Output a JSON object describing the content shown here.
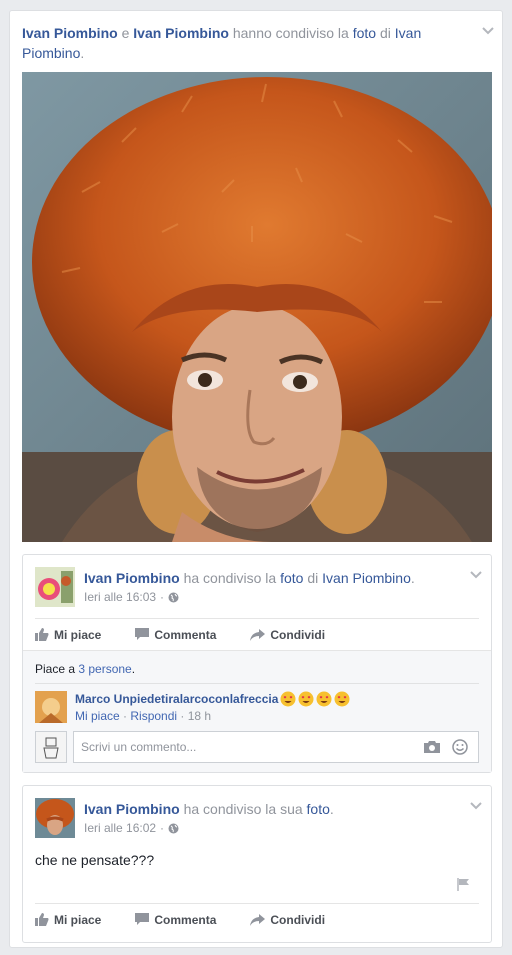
{
  "story": {
    "author1": "Ivan Piombino",
    "conj": " e ",
    "author2": "Ivan Piombino",
    "verb": " hanno condiviso la ",
    "object": "foto",
    "prep": " di ",
    "owner": "Ivan Piombino",
    "period": "."
  },
  "post1": {
    "author": "Ivan Piombino",
    "verb": " ha condiviso la ",
    "object": "foto",
    "prep": " di ",
    "owner": "Ivan Piombino",
    "period": ".",
    "time": "Ieri alle 16:03",
    "dot": " · ",
    "actions": {
      "like": "Mi piace",
      "comment": "Commenta",
      "share": "Condividi"
    },
    "likes_prefix": "Piace a ",
    "likes_link": "3 persone",
    "likes_suffix": ".",
    "comment": {
      "author": "Marco Unpiedetiralarcoconlafreccia",
      "like": "Mi piace",
      "sep": " · ",
      "reply": "Rispondi",
      "sep2": " · ",
      "age": "18 h"
    },
    "reply_placeholder": "Scrivi un commento..."
  },
  "post2": {
    "author": "Ivan Piombino",
    "verb": " ha condiviso la sua ",
    "object": "foto",
    "period": ".",
    "time": "Ieri alle 16:02",
    "dot": " · ",
    "text": "che ne pensate???",
    "actions": {
      "like": "Mi piace",
      "comment": "Commenta",
      "share": "Condividi"
    }
  },
  "colors": {
    "link": "#365899",
    "meta": "#90949c",
    "hat": "#c8561c",
    "background": "#e9ebee"
  },
  "icons": [
    "chevron-down-icon",
    "globe-icon",
    "like-icon",
    "comment-icon",
    "share-icon",
    "camera-icon",
    "smiley-icon",
    "flag-icon",
    "heart-eyes-emoji"
  ]
}
